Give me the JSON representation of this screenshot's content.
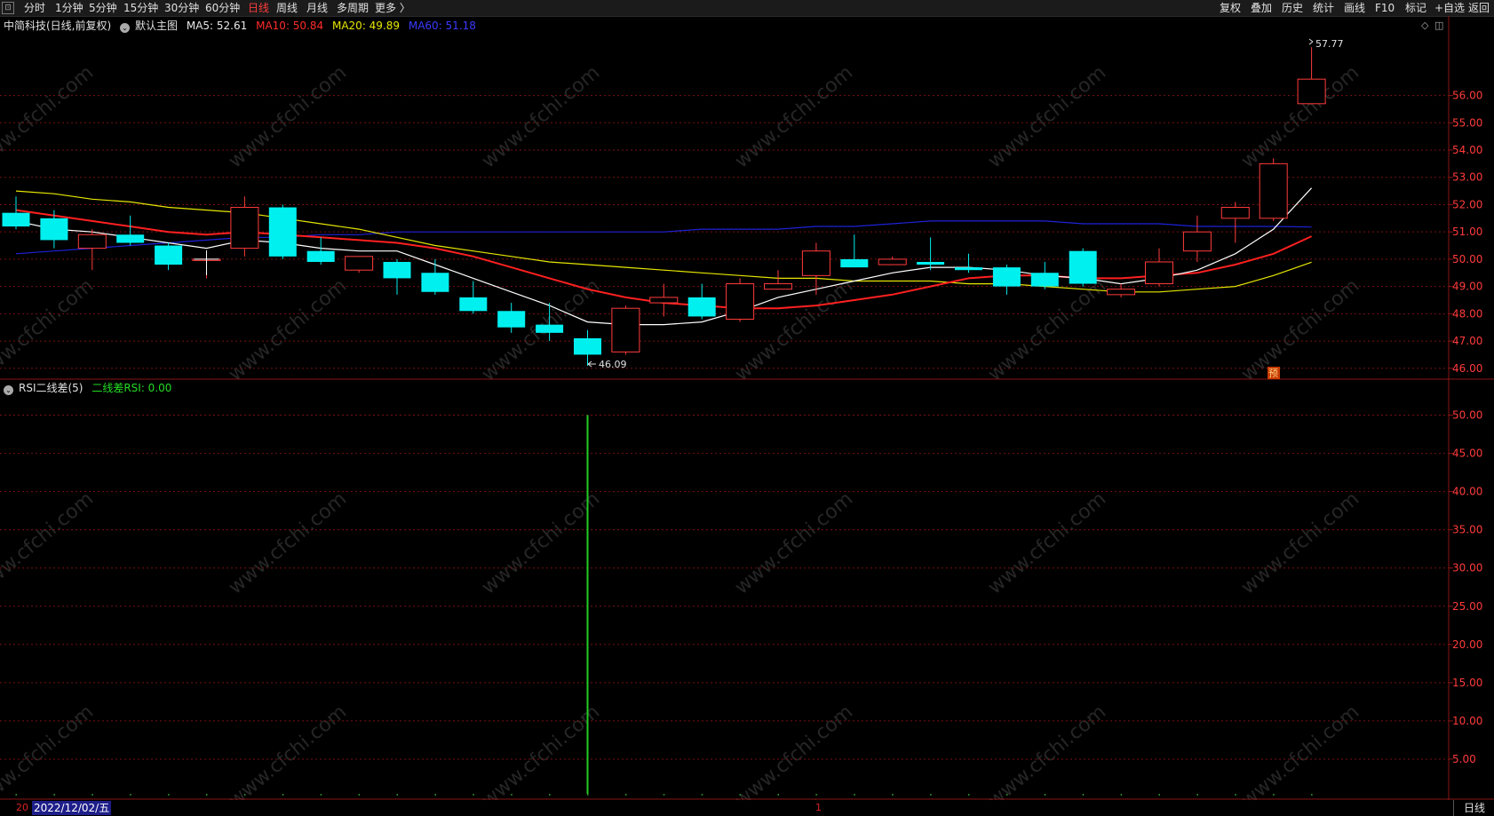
{
  "toolbar": {
    "left": [
      "分时",
      "1分钟",
      "5分钟",
      "15分钟",
      "30分钟",
      "60分钟",
      "日线",
      "周线",
      "月线",
      "多周期",
      "更多 〉"
    ],
    "active": "日线",
    "right": [
      "复权",
      "叠加",
      "历史",
      "统计",
      "画线",
      "F10",
      "标记",
      "+自选",
      "返回"
    ]
  },
  "main_info": {
    "stock": "中简科技(日线,前复权)",
    "template": "默认主图",
    "ma5": "MA5: 52.61",
    "ma10": "MA10: 50.84",
    "ma20": "MA20: 49.89",
    "ma60": "MA60: 51.18"
  },
  "indicator_info": {
    "name": "RSI二线差(5)",
    "value": "二线差RSI: 0.00"
  },
  "labels": {
    "high": "57.77",
    "low": "46.09",
    "forecast_badge": "预"
  },
  "bottom": {
    "date": "2022/12/02/五",
    "left_mark": "20",
    "mid_mark": "1",
    "period": "日线"
  },
  "colors": {
    "up": "#ff3b3b",
    "down": "#00f0f0",
    "ma5": "#ffffff",
    "ma10": "#ff2020",
    "ma20": "#e6e600",
    "ma60": "#1e22d8",
    "rsi_line": "#22cc22",
    "grid": "#7a1010",
    "axis_text": "#ff3b3b"
  },
  "chart_data": [
    {
      "type": "candlestick",
      "title": "中简科技(日线,前复权)",
      "ylim": [
        45.7,
        58.2
      ],
      "y_ticks": [
        "46.00",
        "47.00",
        "48.00",
        "49.00",
        "50.00",
        "51.00",
        "52.00",
        "53.00",
        "54.00",
        "55.00",
        "56.00"
      ],
      "y_tick_values": [
        46,
        47,
        48,
        49,
        50,
        51,
        52,
        53,
        54,
        55,
        56
      ],
      "candles": [
        [
          51.7,
          51.2,
          52.3,
          51.1
        ],
        [
          51.5,
          50.7,
          51.8,
          50.4
        ],
        [
          50.4,
          50.9,
          51.1,
          49.6
        ],
        [
          50.9,
          50.6,
          51.6,
          50.5
        ],
        [
          50.5,
          49.8,
          50.6,
          49.6
        ],
        [
          50.0,
          50.0,
          50.2,
          49.3
        ],
        [
          50.4,
          51.9,
          52.3,
          50.1
        ],
        [
          51.9,
          50.1,
          52.0,
          50.0
        ],
        [
          50.3,
          49.9,
          50.8,
          49.8
        ],
        [
          49.6,
          50.1,
          50.1,
          49.5
        ],
        [
          49.9,
          49.3,
          50.0,
          48.7
        ],
        [
          49.5,
          48.8,
          50.0,
          48.7
        ],
        [
          48.6,
          48.1,
          49.2,
          48.0
        ],
        [
          48.1,
          47.5,
          48.4,
          47.3
        ],
        [
          47.6,
          47.3,
          48.4,
          47.0
        ],
        [
          47.1,
          46.5,
          47.4,
          46.09
        ],
        [
          46.6,
          48.2,
          48.3,
          46.5
        ],
        [
          48.4,
          48.6,
          49.1,
          47.9
        ],
        [
          48.6,
          47.9,
          49.1,
          47.8
        ],
        [
          47.8,
          49.1,
          49.3,
          47.7
        ],
        [
          48.9,
          49.1,
          49.6,
          48.9
        ],
        [
          49.4,
          50.3,
          50.6,
          48.7
        ],
        [
          50.0,
          49.7,
          50.9,
          49.7
        ],
        [
          49.8,
          50.0,
          50.1,
          49.8
        ],
        [
          49.9,
          49.8,
          50.8,
          49.6
        ],
        [
          49.7,
          49.6,
          50.2,
          49.5
        ],
        [
          49.7,
          49.0,
          49.8,
          48.7
        ],
        [
          49.5,
          49.0,
          49.9,
          48.9
        ],
        [
          50.3,
          49.1,
          50.4,
          49.0
        ],
        [
          48.7,
          48.9,
          49.1,
          48.6
        ],
        [
          49.1,
          49.9,
          50.4,
          49.0
        ],
        [
          50.3,
          51.0,
          51.6,
          49.9
        ],
        [
          51.5,
          51.9,
          52.1,
          50.6
        ],
        [
          51.5,
          53.5,
          53.7,
          51.4
        ],
        [
          55.7,
          56.6,
          57.77,
          55.7
        ]
      ],
      "series": [
        {
          "name": "MA5",
          "values": [
            51.4,
            51.1,
            51.0,
            50.8,
            50.6,
            50.4,
            50.7,
            50.6,
            50.4,
            50.3,
            50.3,
            49.8,
            49.3,
            48.8,
            48.3,
            47.7,
            47.6,
            47.6,
            47.7,
            48.1,
            48.6,
            48.9,
            49.2,
            49.5,
            49.7,
            49.7,
            49.6,
            49.4,
            49.3,
            49.1,
            49.3,
            49.6,
            50.2,
            51.1,
            52.61
          ]
        },
        {
          "name": "MA10",
          "values": [
            51.8,
            51.6,
            51.4,
            51.2,
            51.0,
            50.9,
            51.0,
            50.9,
            50.8,
            50.7,
            50.6,
            50.4,
            50.1,
            49.7,
            49.3,
            48.9,
            48.6,
            48.4,
            48.3,
            48.2,
            48.2,
            48.3,
            48.5,
            48.7,
            49.0,
            49.3,
            49.4,
            49.4,
            49.3,
            49.3,
            49.4,
            49.5,
            49.8,
            50.2,
            50.84
          ]
        },
        {
          "name": "MA20",
          "values": [
            52.5,
            52.4,
            52.2,
            52.1,
            51.9,
            51.8,
            51.7,
            51.5,
            51.3,
            51.1,
            50.8,
            50.5,
            50.3,
            50.1,
            49.9,
            49.8,
            49.7,
            49.6,
            49.5,
            49.4,
            49.3,
            49.3,
            49.2,
            49.2,
            49.2,
            49.1,
            49.1,
            49.0,
            48.9,
            48.8,
            48.8,
            48.9,
            49.0,
            49.4,
            49.89
          ]
        },
        {
          "name": "MA60",
          "values": [
            50.2,
            50.3,
            50.4,
            50.5,
            50.6,
            50.7,
            50.8,
            50.8,
            50.9,
            50.9,
            51.0,
            51.0,
            51.0,
            51.0,
            51.0,
            51.0,
            51.0,
            51.0,
            51.1,
            51.1,
            51.1,
            51.2,
            51.2,
            51.3,
            51.4,
            51.4,
            51.4,
            51.4,
            51.3,
            51.3,
            51.3,
            51.2,
            51.2,
            51.2,
            51.18
          ]
        }
      ]
    },
    {
      "type": "bar",
      "title": "RSI二线差(5)",
      "ylim": [
        0,
        52.5
      ],
      "y_ticks": [
        "5.00",
        "10.00",
        "15.00",
        "20.00",
        "25.00",
        "30.00",
        "35.00",
        "40.00",
        "45.00",
        "50.00"
      ],
      "y_tick_values": [
        5,
        10,
        15,
        20,
        25,
        30,
        35,
        40,
        45,
        50
      ],
      "series": [
        {
          "name": "二线差RSI",
          "values": [
            0,
            0,
            0,
            0,
            0,
            0,
            0,
            0,
            0,
            0,
            0,
            0,
            0,
            0,
            0,
            50,
            0,
            0,
            0,
            0,
            0,
            0,
            0,
            0,
            0,
            0,
            0,
            0,
            0,
            0,
            0,
            0,
            0,
            0,
            0
          ]
        }
      ]
    }
  ]
}
